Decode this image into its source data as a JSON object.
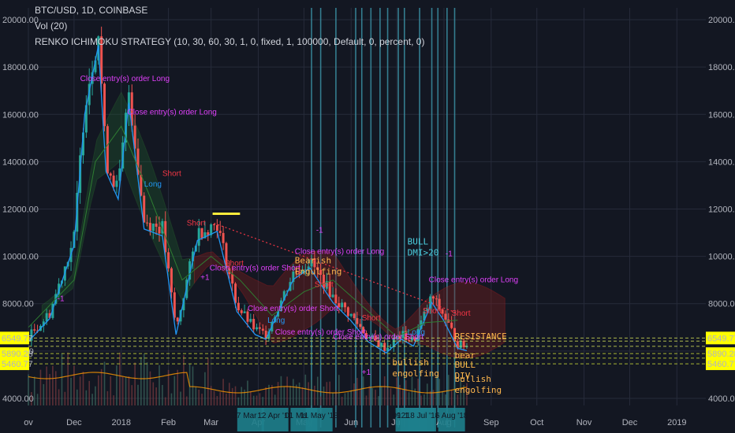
{
  "header": {
    "symbol": "BTC/USD, 1D, COINBASE",
    "volume": "Vol (20)",
    "strategy": "RENKO ICHIMOKU STRATEGY (10, 30, 60, 30, 1, 0, fixed, 1, 100000, Default, 0, percent, 0)"
  },
  "price_tags": [
    "6549.77",
    "5890.28",
    "5460.77"
  ],
  "colors": {
    "background": "#131722",
    "up": "#26a69a",
    "down": "#ef5350",
    "cloud_green": "#1f5e2e",
    "cloud_red": "#7a1f1f",
    "long": "#2196f3",
    "short": "#f23645",
    "signal": "#e040fb",
    "note": "#ffb74d",
    "bull": "#4dd0e1",
    "sr_line": "#d4e157",
    "vol_line": "#ff9800"
  },
  "chart_data": {
    "type": "line",
    "title": "BTC/USD, 1D, COINBASE",
    "xlabel": "",
    "ylabel": "",
    "ylim": [
      3700,
      20500
    ],
    "xlim": [
      "2017-11-01",
      "2019-01-20"
    ],
    "x_tick_labels": [
      "ov",
      "Dec",
      "2018",
      "Feb",
      "Mar",
      "Apr",
      "May",
      "Jun",
      "Jul",
      "Aug",
      "Sep",
      "Oct",
      "Nov",
      "Dec",
      "2019"
    ],
    "x_tick_dates": [
      "2017-11-01",
      "2017-12-01",
      "2018-01-01",
      "2018-02-01",
      "2018-03-01",
      "2018-04-01",
      "2018-05-01",
      "2018-06-01",
      "2018-07-01",
      "2018-08-01",
      "2018-09-01",
      "2018-10-01",
      "2018-11-01",
      "2018-12-01",
      "2019-01-01"
    ],
    "y_tick_labels": [
      "4000.00",
      "6000.00",
      "8000.00",
      "10000.00",
      "12000.00",
      "14000.00",
      "16000.00",
      "18000.00",
      "20000.00"
    ],
    "y_ticks": [
      4000,
      6000,
      8000,
      10000,
      12000,
      14000,
      16000,
      18000,
      20000
    ],
    "date_badges": [
      "27 Mar '18",
      "12 Apr '18",
      "01 May '18",
      "11 May '18",
      "09 Jul '18",
      "12 Jul '18",
      "17 Jul '18",
      "18 Jul '18",
      "6 Aug '18"
    ],
    "badge_dates": [
      "2018-03-27",
      "2018-04-12",
      "2018-05-01",
      "2018-05-11",
      "2018-07-09",
      "2018-07-12",
      "2018-07-17",
      "2018-07-18",
      "2018-08-06"
    ],
    "vertical_line_dates": [
      "2018-05-06",
      "2018-05-12",
      "2018-05-22",
      "2018-06-04",
      "2018-06-08",
      "2018-06-14",
      "2018-06-20",
      "2018-06-25",
      "2018-07-02",
      "2018-07-06",
      "2018-07-16",
      "2018-07-24",
      "2018-07-28",
      "2018-08-03",
      "2018-08-08"
    ],
    "sr_levels": [
      6549.77,
      6420,
      6200,
      5890.28,
      5700,
      5460.77
    ],
    "series": [
      {
        "name": "",
        "x": [
          "2017-11-01",
          "2017-11-15",
          "2017-12-01",
          "2017-12-08",
          "2017-12-17",
          "2017-12-22",
          "2017-12-30",
          "2018-01-06",
          "2018-01-16",
          "2018-01-28",
          "2018-02-06",
          "2018-02-20",
          "2018-03-05",
          "2018-03-18",
          "2018-03-30",
          "2018-04-06",
          "2018-04-24",
          "2018-05-05",
          "2018-05-20",
          "2018-06-01",
          "2018-06-12",
          "2018-06-24",
          "2018-07-04",
          "2018-07-12",
          "2018-07-24",
          "2018-08-01",
          "2018-08-10",
          "2018-08-16"
        ],
        "y": [
          6600,
          7600,
          10800,
          16500,
          19500,
          14000,
          12800,
          17000,
          11500,
          11200,
          6900,
          11000,
          11400,
          7900,
          6900,
          6700,
          9300,
          9800,
          8300,
          7500,
          6600,
          6100,
          6700,
          6400,
          8300,
          7500,
          6300,
          6200
        ]
      },
      {
        "name": "",
        "x": [
          "2017-11-01",
          "2017-12-01",
          "2017-12-15",
          "2018-01-01",
          "2018-01-20",
          "2018-02-10",
          "2018-03-01",
          "2018-03-20",
          "2018-04-10",
          "2018-05-01",
          "2018-05-20",
          "2018-06-10",
          "2018-07-01",
          "2018-07-20",
          "2018-08-10"
        ],
        "y": [
          7000,
          9000,
          14000,
          15500,
          12500,
          9000,
          10000,
          9000,
          7500,
          8500,
          9000,
          7800,
          6600,
          7200,
          7300
        ]
      }
    ],
    "annotations": [
      "Close entry(s) order Long",
      "Close entry(s) order Short",
      "Long",
      "Short",
      "Bearish Engulfing",
      "BULL DMI>20",
      "bullish engolfing",
      "RESISTANCE",
      "bear",
      "BULL DIV",
      "-1",
      "+1"
    ]
  }
}
